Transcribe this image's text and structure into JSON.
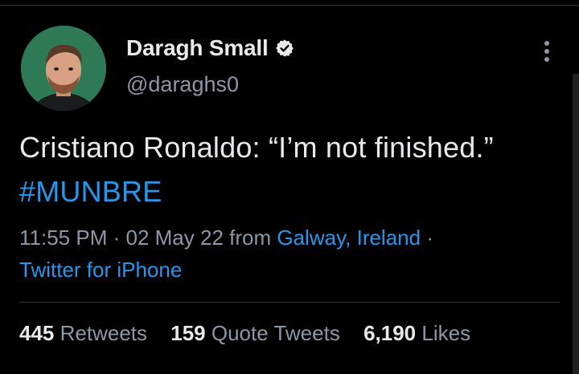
{
  "tweet": {
    "author": {
      "display_name": "Daragh Small",
      "handle": "@daraghs0",
      "verified": true,
      "avatar": "profile-photo"
    },
    "text": "Cristiano Ronaldo: “I’m not finished.”",
    "hashtag": "#MUNBRE",
    "meta": {
      "time": "11:55 PM",
      "separator": "·",
      "date": "02 May 22",
      "from_label": "from",
      "location": "Galway, Ireland",
      "client": "Twitter for iPhone"
    },
    "stats": {
      "retweets": {
        "count": "445",
        "label": "Retweets"
      },
      "quotes": {
        "count": "159",
        "label": "Quote Tweets"
      },
      "likes": {
        "count": "6,190",
        "label": "Likes"
      }
    }
  },
  "colors": {
    "background": "#000000",
    "text": "#e7e9ea",
    "secondary": "#8b98a5",
    "accent": "#1d9bf0",
    "divider": "#2f3336"
  },
  "icons": {
    "verified": "verified-badge-icon",
    "more": "more-options-icon"
  }
}
